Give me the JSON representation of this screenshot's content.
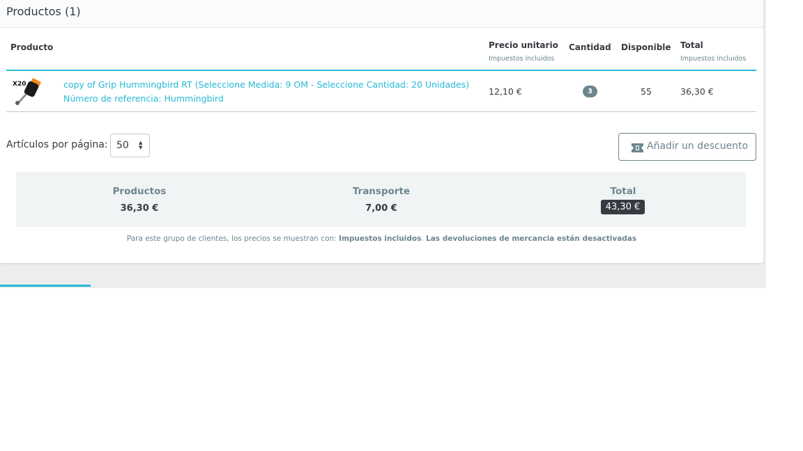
{
  "card": {
    "title": "Productos (1)"
  },
  "table": {
    "headers": {
      "product": "Producto",
      "unit_price": "Precio unitario",
      "unit_price_sub": "Impuestos incluidos",
      "quantity": "Cantidad",
      "available": "Disponible",
      "total": "Total",
      "total_sub": "Impuestos incluidos"
    },
    "rows": [
      {
        "image_badge": "X20",
        "name": "copy of Grip Hummingbird RT (Seleccione Medida: 9 OM - Seleccione Cantidad: 20 Unidades)",
        "reference": "Número de referencia: Hummingbird",
        "unit_price": "12,10 €",
        "quantity": "3",
        "available": "55",
        "total": "36,30 €"
      }
    ]
  },
  "pagination": {
    "label": "Artículos por página:",
    "value": "50"
  },
  "discount_button": {
    "label": "Añadir un descuento",
    "icon": "ticket-icon"
  },
  "summary": {
    "products_label": "Productos",
    "products_value": "36,30 €",
    "shipping_label": "Transporte",
    "shipping_value": "7,00 €",
    "total_label": "Total",
    "total_value": "43,30 €"
  },
  "footnote": {
    "prefix": "Para este grupo de clientes, los precios se muestran con: ",
    "taxes": "Impuestos incluidos",
    "separator": ". ",
    "returns": "Las devoluciones de mercancia están desactivadas"
  },
  "colors": {
    "accent": "#25b9d7",
    "text": "#363a41",
    "muted": "#6c868e"
  }
}
